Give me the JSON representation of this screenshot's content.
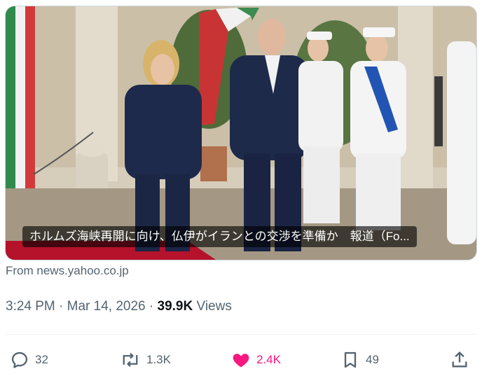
{
  "card": {
    "caption": "ホルムズ海峡再開に向け、仏伊がイランとの交渉を準備か　報道（Fo..."
  },
  "source": {
    "text": "From news.yahoo.co.jp"
  },
  "meta": {
    "time": "3:24 PM",
    "sep1": "·",
    "date": "Mar 14, 2026",
    "sep2": "·",
    "views_count": "39.9K",
    "views_label": "Views"
  },
  "actions": {
    "replies": "32",
    "reposts": "1.3K",
    "likes": "2.4K",
    "bookmarks": "49"
  },
  "colors": {
    "secondary_text": "#536471",
    "like_pink": "#f91880",
    "divider": "#eff3f4"
  },
  "icons": [
    "reply-icon",
    "repost-icon",
    "heart-filled-icon",
    "bookmark-icon",
    "share-icon"
  ]
}
